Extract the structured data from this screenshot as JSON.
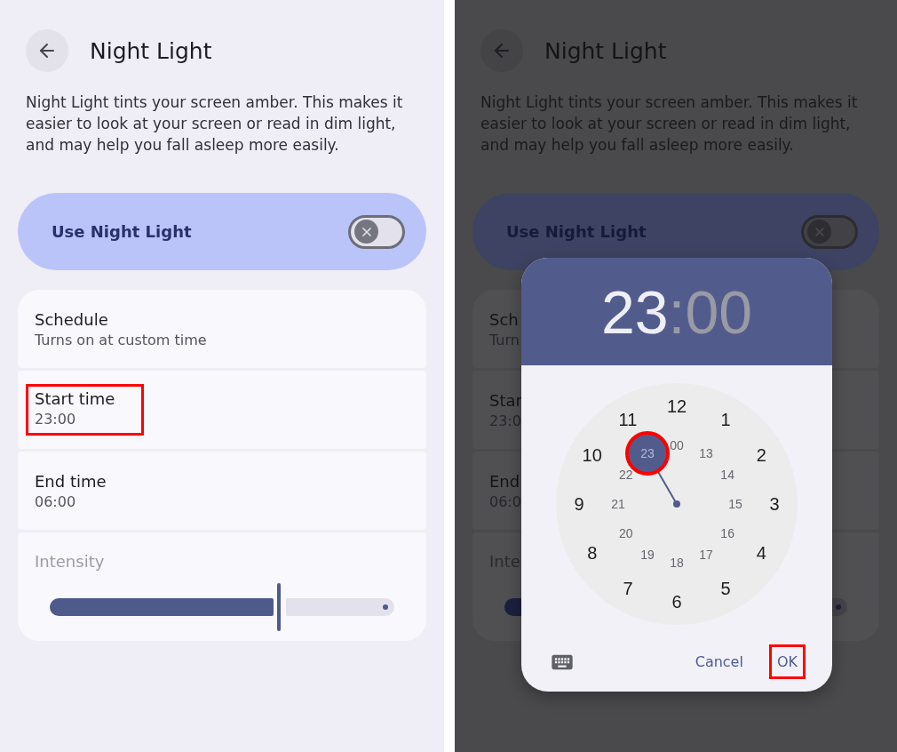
{
  "screens": [
    {
      "kind": "settings",
      "dimmed": false,
      "title": "Night Light",
      "description": "Night Light tints your screen amber. This makes it easier to look at your screen or read in dim light, and may help you fall asleep more easily.",
      "master_switch": {
        "label": "Use Night Light",
        "on": false
      },
      "items": [
        {
          "title": "Schedule",
          "subtitle": "Turns on at custom time",
          "highlighted": false
        },
        {
          "title": "Start time",
          "subtitle": "23:00",
          "highlighted": true
        },
        {
          "title": "End time",
          "subtitle": "06:00",
          "highlighted": false
        }
      ],
      "intensity": {
        "label": "Intensity",
        "level": 0.68,
        "disabled": true
      }
    },
    {
      "kind": "settings",
      "dimmed": true,
      "title": "Night Light",
      "description": "Night Light tints your screen amber. This makes it easier to look at your screen or read in dim light, and may help you fall asleep more easily.",
      "master_switch": {
        "label": "Use Night Light",
        "on": false
      },
      "items": [
        {
          "title": "Sch",
          "subtitle": "Turn",
          "highlighted": false
        },
        {
          "title": "Star",
          "subtitle": "23:0",
          "highlighted": false
        },
        {
          "title": "End",
          "subtitle": "06:0",
          "highlighted": false
        }
      ],
      "intensity": {
        "label": "Inte",
        "level": 0.68,
        "disabled": true
      }
    }
  ],
  "time_picker": {
    "hour": "23",
    "separator": ":",
    "minute": "00",
    "hour_active": true,
    "outer_hours": [
      {
        "label": "12",
        "selected": false
      },
      {
        "label": "1",
        "selected": false
      },
      {
        "label": "2",
        "selected": false
      },
      {
        "label": "3",
        "selected": false
      },
      {
        "label": "4",
        "selected": false
      },
      {
        "label": "5",
        "selected": false
      },
      {
        "label": "6",
        "selected": false
      },
      {
        "label": "7",
        "selected": false
      },
      {
        "label": "8",
        "selected": false
      },
      {
        "label": "9",
        "selected": false
      },
      {
        "label": "10",
        "selected": false
      },
      {
        "label": "11",
        "selected": false
      }
    ],
    "inner_hours": [
      {
        "label": "00",
        "selected": false
      },
      {
        "label": "13",
        "selected": false
      },
      {
        "label": "14",
        "selected": false
      },
      {
        "label": "15",
        "selected": false
      },
      {
        "label": "16",
        "selected": false
      },
      {
        "label": "17",
        "selected": false
      },
      {
        "label": "18",
        "selected": false
      },
      {
        "label": "19",
        "selected": false
      },
      {
        "label": "20",
        "selected": false
      },
      {
        "label": "21",
        "selected": false
      },
      {
        "label": "22",
        "selected": false
      },
      {
        "label": "23",
        "selected": true
      }
    ],
    "selection_highlighted": true,
    "buttons": [
      {
        "label": "Cancel",
        "highlighted": false
      },
      {
        "label": "OK",
        "highlighted": true
      }
    ]
  }
}
